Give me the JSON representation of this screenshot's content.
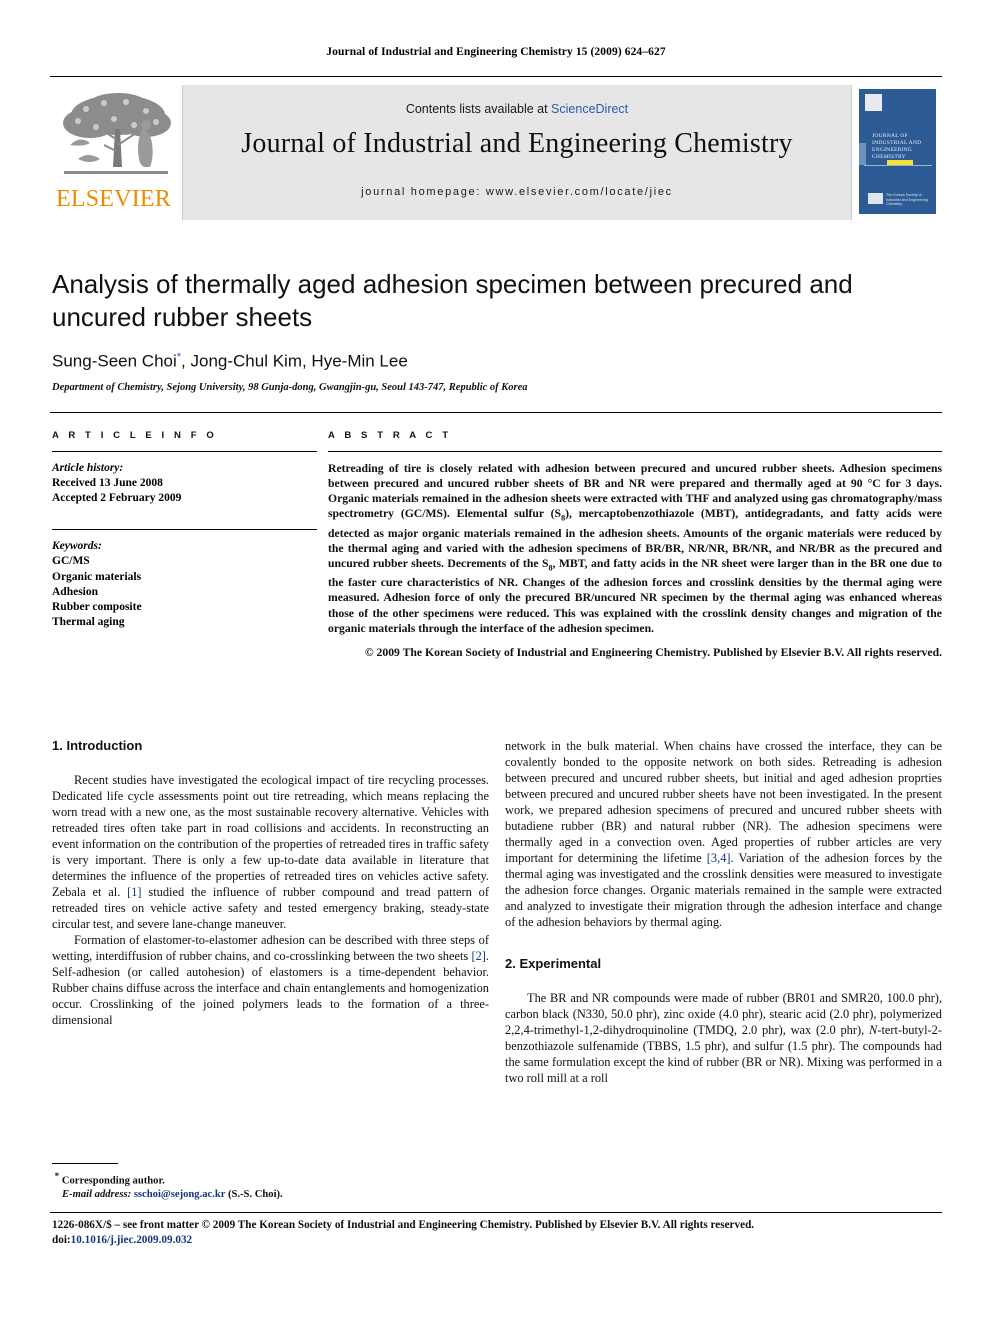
{
  "header": {
    "running_head": "Journal of Industrial and Engineering Chemistry 15 (2009) 624–627"
  },
  "masthead": {
    "contents_prefix": "Contents lists available at ",
    "sciencedirect": "ScienceDirect",
    "journal_title": "Journal of Industrial and Engineering Chemistry",
    "homepage": "journal homepage: www.elsevier.com/locate/jiec",
    "publisher_wordmark": "ELSEVIER",
    "cover_title": "JOURNAL OF INDUSTRIAL AND ENGINEERING CHEMISTRY",
    "cover_society": "The Korean Society of Industrial and Engineering Chemistry",
    "accent_orange": "#ed8b00",
    "accent_blue": "#2b5caa",
    "cover_blue": "#2d5b95",
    "banner_gray": "#e6e6e6"
  },
  "article": {
    "title": "Analysis of thermally aged adhesion specimen between precured and uncured rubber sheets",
    "authors": "Sung-Seen Choi",
    "authors_rest": ", Jong-Chul Kim, Hye-Min Lee",
    "corresponding_mark": "*",
    "affiliation": "Department of Chemistry, Sejong University, 98 Gunja-dong, Gwangjin-gu, Seoul 143-747, Republic of Korea"
  },
  "article_info": {
    "heading": "A R T I C L E   I N F O",
    "history_label": "Article history:",
    "received": "Received 13 June 2008",
    "accepted": "Accepted 2 February 2009",
    "keywords_label": "Keywords:",
    "keywords": [
      "GC/MS",
      "Organic materials",
      "Adhesion",
      "Rubber composite",
      "Thermal aging"
    ]
  },
  "abstract": {
    "heading": "A B S T R A C T",
    "body_1": "Retreading of tire is closely related with adhesion between precured and uncured rubber sheets. Adhesion specimens between precured and uncured rubber sheets of BR and NR were prepared and thermally aged at 90 °C for 3 days. Organic materials remained in the adhesion sheets were extracted with THF and analyzed using gas chromatography/mass spectrometry (GC/MS). Elemental sulfur (S",
    "sub_1": "8",
    "body_2": "), mercaptobenzothiazole (MBT), antidegradants, and fatty acids were detected as major organic materials remained in the adhesion sheets. Amounts of the organic materials were reduced by the thermal aging and varied with the adhesion specimens of BR/BR, NR/NR, BR/NR, and NR/BR as the precured and uncured rubber sheets. Decrements of the S",
    "sub_2": "8",
    "body_3": ", MBT, and fatty acids in the NR sheet were larger than in the BR one due to the faster cure characteristics of NR. Changes of the adhesion forces and crosslink densities by the thermal aging were measured. Adhesion force of only the precured BR/uncured NR specimen by the thermal aging was enhanced whereas those of the other specimens were reduced. This was explained with the crosslink density changes and migration of the organic materials through the interface of the adhesion specimen.",
    "copyright": "© 2009 The Korean Society of Industrial and Engineering Chemistry. Published by Elsevier B.V. All rights reserved."
  },
  "sections": {
    "introduction_title": "1. Introduction",
    "experimental_title": "2. Experimental",
    "intro_p1_a": "Recent studies have investigated the ecological impact of tire recycling processes. Dedicated life cycle assessments point out tire retreading, which means replacing the worn tread with a new one, as the most sustainable recovery alternative. Vehicles with retreaded tires often take part in road collisions and accidents. In reconstructing an event information on the contribution of the properties of retreaded tires in traffic safety is very important. There is only a few up-to-date data available in literature that determines the influence of the properties of retreaded tires on vehicles active safety. Zebala et al. ",
    "intro_p1_ref": "[1]",
    "intro_p1_b": " studied the influence of rubber compound and tread pattern of retreaded tires on vehicle active safety and tested emergency braking, steady-state circular test, and severe lane-change maneuver.",
    "intro_p2_a": "Formation of elastomer-to-elastomer adhesion can be described with three steps of wetting, interdiffusion of rubber chains, and co-crosslinking between the two sheets ",
    "intro_p2_ref": "[2]",
    "intro_p2_b": ". Self-adhesion (or called autohesion) of elastomers is a time-dependent behavior. Rubber chains diffuse across the interface and chain entanglements and homogenization occur. Crosslinking of the joined polymers leads to the formation of a three-dimensional",
    "intro_p3_a": "network in the bulk material. When chains have crossed the interface, they can be covalently bonded to the opposite network on both sides. Retreading is adhesion between precured and uncured rubber sheets, but initial and aged adhesion proprties between precured and uncured rubber sheets have not been investigated. In the present work, we prepared adhesion specimens of precured and uncured rubber sheets with butadiene rubber (BR) and natural rubber (NR). The adhesion specimens were thermally aged in a convection oven. Aged properties of rubber articles are very important for determining the lifetime ",
    "intro_p3_ref": "[3,4]",
    "intro_p3_b": ". Variation of the adhesion forces by the thermal aging was investigated and the crosslink densities were measured to investigate the adhesion force changes. Organic materials remained in the sample were extracted and analyzed to investigate their migration through the adhesion interface and change of the adhesion behaviors by thermal aging.",
    "exp_p1_a": "The BR and NR compounds were made of rubber (BR01 and SMR20, 100.0 phr), carbon black (N330, 50.0 phr), zinc oxide (4.0 phr), stearic acid (2.0 phr), polymerized 2,2,4-trimethyl-1,2-dihydroquinoline (TMDQ, 2.0 phr), wax (2.0 phr), ",
    "exp_p1_italic": "N",
    "exp_p1_b": "-tert-butyl-2-benzothiazole sulfenamide (TBBS, 1.5 phr), and sulfur (1.5 phr). The compounds had the same formulation except the kind of rubber (BR or NR). Mixing was performed in a two roll mill at a roll"
  },
  "footnote": {
    "star": "*",
    "corresponding": "Corresponding author.",
    "email_label": "E-mail address:",
    "email": "sschoi@sejong.ac.kr",
    "email_owner": "(S.-S. Choi)."
  },
  "footer": {
    "issn_line": "1226-086X/$ – see front matter © 2009 The Korean Society of Industrial and Engineering Chemistry. Published by Elsevier B.V. All rights reserved.",
    "doi_label": "doi:",
    "doi": "10.1016/j.jiec.2009.09.032"
  }
}
